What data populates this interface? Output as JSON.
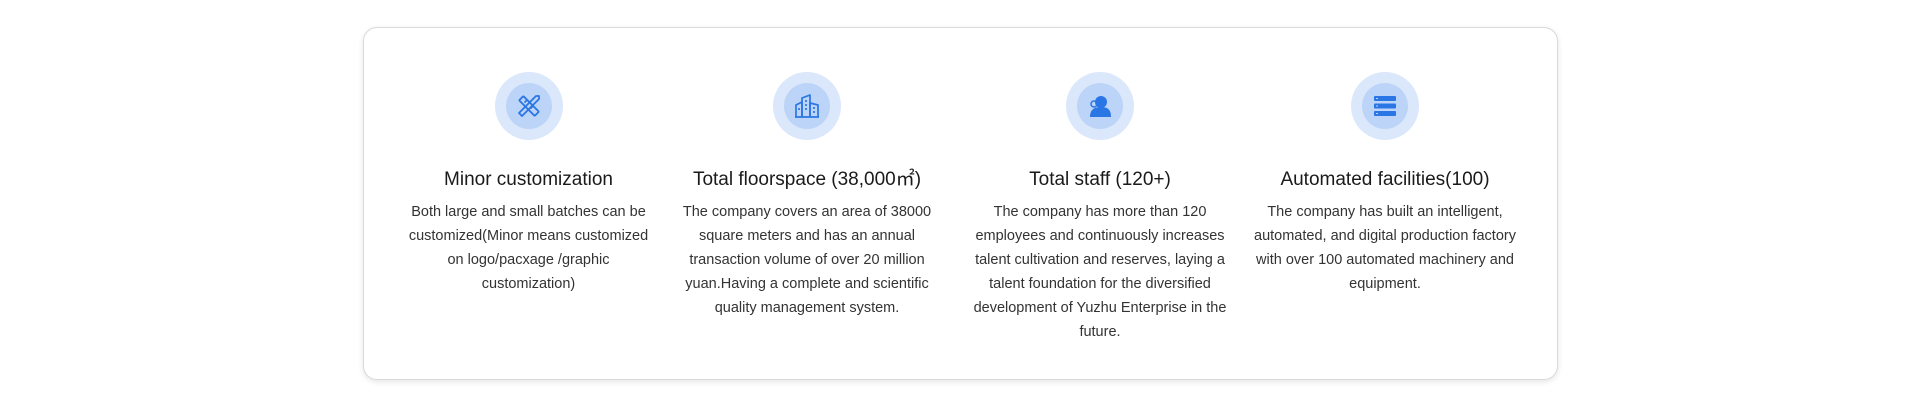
{
  "colors": {
    "icon_ring": "#dbe7fb",
    "icon_fill": "#bcd4f7",
    "icon_stroke": "#2b76e5",
    "card_border": "#d9d9d9"
  },
  "features": [
    {
      "icon": "ruler-pencil-icon",
      "title": "Minor customization",
      "description": "Both large and small batches can be customized(Minor means customized on logo/pacxage /graphic customization)"
    },
    {
      "icon": "buildings-icon",
      "title": "Total floorspace (38,000㎡)",
      "description": "The company covers an area of 38000 square meters and has an annual transaction volume of over 20 million yuan.Having a complete and scientific quality management system."
    },
    {
      "icon": "staff-icon",
      "title": "Total staff (120+)",
      "description": "The company has more than 120 employees and continuously increases talent cultivation and reserves, laying a talent foundation for the diversified development of Yuzhu Enterprise in the future."
    },
    {
      "icon": "server-stack-icon",
      "title": "Automated facilities(100)",
      "description": "The company has built an intelligent, automated, and digital production factory with over 100 automated machinery and equipment."
    }
  ]
}
